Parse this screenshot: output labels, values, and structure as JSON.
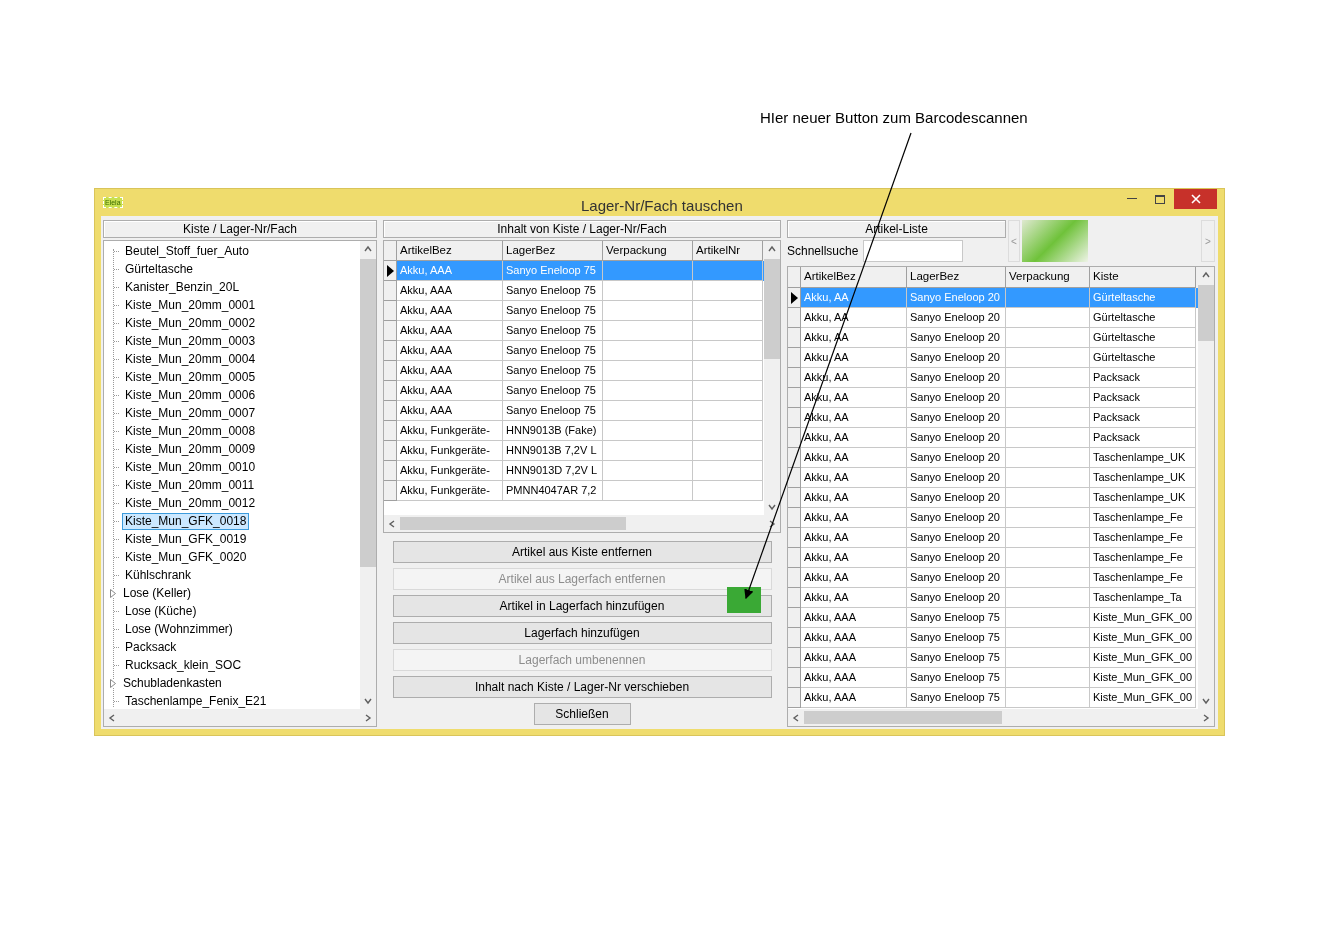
{
  "annotation": {
    "text": "HIer neuer Button zum Barcodescannen"
  },
  "window": {
    "title": "Lager-Nr/Fach tauschen",
    "app_icon_label": "Elela"
  },
  "left_panel": {
    "heading": "Kiste / Lager-Nr/Fach",
    "items": [
      {
        "label": "Beutel_Stoff_fuer_Auto",
        "expandable": false,
        "selected": false
      },
      {
        "label": "Gürteltasche",
        "expandable": false,
        "selected": false
      },
      {
        "label": "Kanister_Benzin_20L",
        "expandable": false,
        "selected": false
      },
      {
        "label": "Kiste_Mun_20mm_0001",
        "expandable": false,
        "selected": false
      },
      {
        "label": "Kiste_Mun_20mm_0002",
        "expandable": false,
        "selected": false
      },
      {
        "label": "Kiste_Mun_20mm_0003",
        "expandable": false,
        "selected": false
      },
      {
        "label": "Kiste_Mun_20mm_0004",
        "expandable": false,
        "selected": false
      },
      {
        "label": "Kiste_Mun_20mm_0005",
        "expandable": false,
        "selected": false
      },
      {
        "label": "Kiste_Mun_20mm_0006",
        "expandable": false,
        "selected": false
      },
      {
        "label": "Kiste_Mun_20mm_0007",
        "expandable": false,
        "selected": false
      },
      {
        "label": "Kiste_Mun_20mm_0008",
        "expandable": false,
        "selected": false
      },
      {
        "label": "Kiste_Mun_20mm_0009",
        "expandable": false,
        "selected": false
      },
      {
        "label": "Kiste_Mun_20mm_0010",
        "expandable": false,
        "selected": false
      },
      {
        "label": "Kiste_Mun_20mm_0011",
        "expandable": false,
        "selected": false
      },
      {
        "label": "Kiste_Mun_20mm_0012",
        "expandable": false,
        "selected": false
      },
      {
        "label": "Kiste_Mun_GFK_0018",
        "expandable": false,
        "selected": true
      },
      {
        "label": "Kiste_Mun_GFK_0019",
        "expandable": false,
        "selected": false
      },
      {
        "label": "Kiste_Mun_GFK_0020",
        "expandable": false,
        "selected": false
      },
      {
        "label": "Kühlschrank",
        "expandable": false,
        "selected": false
      },
      {
        "label": "Lose (Keller)",
        "expandable": true,
        "selected": false
      },
      {
        "label": "Lose (Küche)",
        "expandable": false,
        "selected": false
      },
      {
        "label": "Lose (Wohnzimmer)",
        "expandable": false,
        "selected": false
      },
      {
        "label": "Packsack",
        "expandable": false,
        "selected": false
      },
      {
        "label": "Rucksack_klein_SOC",
        "expandable": false,
        "selected": false
      },
      {
        "label": "Schubladenkasten",
        "expandable": true,
        "selected": false
      },
      {
        "label": "Taschenlampe_Fenix_E21",
        "expandable": false,
        "selected": false
      }
    ]
  },
  "middle_panel": {
    "heading": "Inhalt von Kiste / Lager-Nr/Fach",
    "columns": [
      "ArtikelBez",
      "LagerBez",
      "Verpackung",
      "ArtikelNr"
    ],
    "rows": [
      {
        "cells": [
          "Akku, AAA",
          "Sanyo Eneloop 75"
        ],
        "selected": true
      },
      {
        "cells": [
          "Akku, AAA",
          "Sanyo Eneloop 75"
        ],
        "selected": false
      },
      {
        "cells": [
          "Akku, AAA",
          "Sanyo Eneloop 75"
        ],
        "selected": false
      },
      {
        "cells": [
          "Akku, AAA",
          "Sanyo Eneloop 75"
        ],
        "selected": false
      },
      {
        "cells": [
          "Akku, AAA",
          "Sanyo Eneloop 75"
        ],
        "selected": false
      },
      {
        "cells": [
          "Akku, AAA",
          "Sanyo Eneloop 75"
        ],
        "selected": false
      },
      {
        "cells": [
          "Akku, AAA",
          "Sanyo Eneloop 75"
        ],
        "selected": false
      },
      {
        "cells": [
          "Akku, AAA",
          "Sanyo Eneloop 75"
        ],
        "selected": false
      },
      {
        "cells": [
          "Akku, Funkgeräte-",
          "HNN9013B (Fake)"
        ],
        "selected": false
      },
      {
        "cells": [
          "Akku, Funkgeräte-",
          "HNN9013B 7,2V L"
        ],
        "selected": false
      },
      {
        "cells": [
          "Akku, Funkgeräte-",
          "HNN9013D 7,2V L"
        ],
        "selected": false
      },
      {
        "cells": [
          "Akku, Funkgeräte-",
          "PMNN4047AR 7,2"
        ],
        "selected": false
      }
    ],
    "buttons": [
      {
        "label": "Artikel aus Kiste entfernen",
        "disabled": false
      },
      {
        "label": "Artikel aus Lagerfach entfernen",
        "disabled": true
      },
      {
        "label": "Artikel in Lagerfach hinzufügen",
        "disabled": false
      },
      {
        "label": "Lagerfach hinzufügen",
        "disabled": false
      },
      {
        "label": "Lagerfach umbenennen",
        "disabled": true
      },
      {
        "label": "Inhalt nach Kiste / Lager-Nr verschieben",
        "disabled": false
      }
    ],
    "close_button": "Schließen"
  },
  "right_panel": {
    "heading": "Artikel-Liste",
    "search": {
      "label": "Schnellsuche"
    },
    "image_prev": "<",
    "image_next": ">",
    "columns": [
      "ArtikelBez",
      "LagerBez",
      "Verpackung",
      "Kiste"
    ],
    "rows": [
      {
        "cells": [
          "Akku, AA",
          "Sanyo Eneloop 20",
          "",
          "Gürteltasche"
        ],
        "selected": true
      },
      {
        "cells": [
          "Akku, AA",
          "Sanyo Eneloop 20",
          "",
          "Gürteltasche"
        ],
        "selected": false
      },
      {
        "cells": [
          "Akku, AA",
          "Sanyo Eneloop 20",
          "",
          "Gürteltasche"
        ],
        "selected": false
      },
      {
        "cells": [
          "Akku, AA",
          "Sanyo Eneloop 20",
          "",
          "Gürteltasche"
        ],
        "selected": false
      },
      {
        "cells": [
          "Akku, AA",
          "Sanyo Eneloop 20",
          "",
          "Packsack"
        ],
        "selected": false
      },
      {
        "cells": [
          "Akku, AA",
          "Sanyo Eneloop 20",
          "",
          "Packsack"
        ],
        "selected": false
      },
      {
        "cells": [
          "Akku, AA",
          "Sanyo Eneloop 20",
          "",
          "Packsack"
        ],
        "selected": false
      },
      {
        "cells": [
          "Akku, AA",
          "Sanyo Eneloop 20",
          "",
          "Packsack"
        ],
        "selected": false
      },
      {
        "cells": [
          "Akku, AA",
          "Sanyo Eneloop 20",
          "",
          "Taschenlampe_UK"
        ],
        "selected": false
      },
      {
        "cells": [
          "Akku, AA",
          "Sanyo Eneloop 20",
          "",
          "Taschenlampe_UK"
        ],
        "selected": false
      },
      {
        "cells": [
          "Akku, AA",
          "Sanyo Eneloop 20",
          "",
          "Taschenlampe_UK"
        ],
        "selected": false
      },
      {
        "cells": [
          "Akku, AA",
          "Sanyo Eneloop 20",
          "",
          "Taschenlampe_Fe"
        ],
        "selected": false
      },
      {
        "cells": [
          "Akku, AA",
          "Sanyo Eneloop 20",
          "",
          "Taschenlampe_Fe"
        ],
        "selected": false
      },
      {
        "cells": [
          "Akku, AA",
          "Sanyo Eneloop 20",
          "",
          "Taschenlampe_Fe"
        ],
        "selected": false
      },
      {
        "cells": [
          "Akku, AA",
          "Sanyo Eneloop 20",
          "",
          "Taschenlampe_Fe"
        ],
        "selected": false
      },
      {
        "cells": [
          "Akku, AA",
          "Sanyo Eneloop 20",
          "",
          "Taschenlampe_Ta"
        ],
        "selected": false
      },
      {
        "cells": [
          "Akku, AAA",
          "Sanyo Eneloop 75",
          "",
          "Kiste_Mun_GFK_00"
        ],
        "selected": false
      },
      {
        "cells": [
          "Akku, AAA",
          "Sanyo Eneloop 75",
          "",
          "Kiste_Mun_GFK_00"
        ],
        "selected": false
      },
      {
        "cells": [
          "Akku, AAA",
          "Sanyo Eneloop 75",
          "",
          "Kiste_Mun_GFK_00"
        ],
        "selected": false
      },
      {
        "cells": [
          "Akku, AAA",
          "Sanyo Eneloop 75",
          "",
          "Kiste_Mun_GFK_00"
        ],
        "selected": false
      },
      {
        "cells": [
          "Akku, AAA",
          "Sanyo Eneloop 75",
          "",
          "Kiste_Mun_GFK_00"
        ],
        "selected": false
      }
    ]
  }
}
